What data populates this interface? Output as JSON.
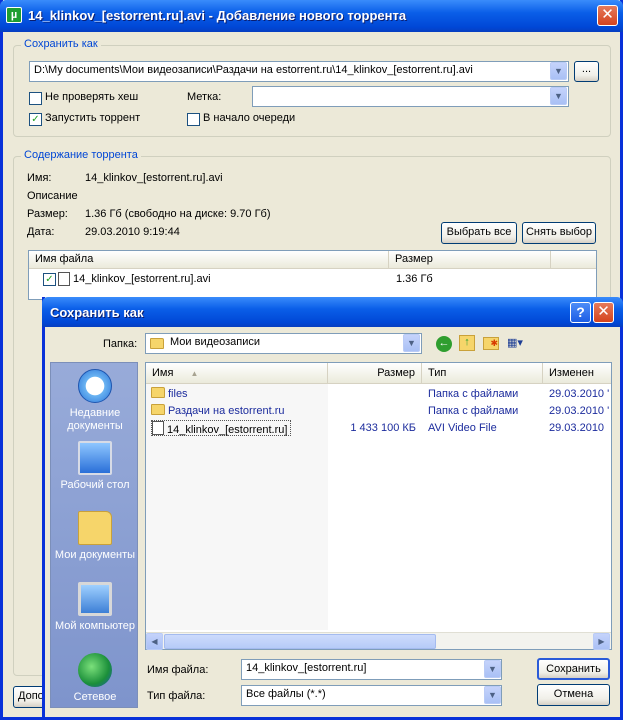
{
  "main": {
    "title": "14_klinkov_[estorrent.ru].avi - Добавление нового торрента",
    "save_as_group": "Сохранить как",
    "save_path": "D:\\My documents\\Мои видеозаписи\\Раздачи на estorrent.ru\\14_klinkov_[estorrent.ru].avi",
    "browse_label": "...",
    "skip_hash_label": "Не проверять хеш",
    "skip_hash_checked": false,
    "label_label": "Метка:",
    "label_value": "",
    "start_torrent_label": "Запустить торрент",
    "start_torrent_checked": true,
    "queue_top_label": "В начало очереди",
    "queue_top_checked": false,
    "content_group": "Содержание торрента",
    "name_key": "Имя:",
    "name_value": "14_klinkov_[estorrent.ru].avi",
    "description_key": "Описание",
    "size_key": "Размер:",
    "size_value": "1.36 Гб (свободно на диске: 9.70 Гб)",
    "date_key": "Дата:",
    "date_value": "29.03.2010 9:19:44",
    "select_all_label": "Выбрать все",
    "deselect_label": "Снять выбор",
    "file_table": {
      "columns": [
        "Имя файла",
        "Размер"
      ],
      "rows": [
        {
          "name": "14_klinkov_[estorrent.ru].avi",
          "size": "1.36 Гб",
          "checked": true
        }
      ]
    },
    "bottom_button_partial": "Допо"
  },
  "dialog": {
    "title": "Сохранить как",
    "help_label": "?",
    "folder_label": "Папка:",
    "folder_value": "Мои видеозаписи",
    "places": [
      {
        "label": "Недавние документы",
        "icon": "recent-documents-icon"
      },
      {
        "label": "Рабочий стол",
        "icon": "desktop-icon"
      },
      {
        "label": "Мои документы",
        "icon": "my-documents-icon"
      },
      {
        "label": "Мой компьютер",
        "icon": "my-computer-icon"
      },
      {
        "label": "Сетевое",
        "icon": "network-icon"
      }
    ],
    "columns": [
      "Имя",
      "Размер",
      "Тип",
      "Изменен"
    ],
    "files": [
      {
        "name": "files",
        "size": "",
        "type": "Папка с файлами",
        "modified": "29.03.2010 '",
        "kind": "folder"
      },
      {
        "name": "Раздачи на estorrent.ru",
        "size": "",
        "type": "Папка с файлами",
        "modified": "29.03.2010 '",
        "kind": "folder"
      },
      {
        "name": "14_klinkov_[estorrent.ru]",
        "size": "1 433 100 КБ",
        "type": "AVI Video File",
        "modified": "29.03.2010",
        "kind": "file"
      }
    ],
    "filename_label": "Имя файла:",
    "filename_value": "14_klinkov_[estorrent.ru]",
    "filetype_label": "Тип файла:",
    "filetype_value": "Все файлы (*.*)",
    "save_label": "Сохранить",
    "cancel_label": "Отмена"
  },
  "colors": {
    "title_bar": "#0a5ee8",
    "window_bg": "#ece9d8",
    "group_label": "#0046d5",
    "link_blue": "#1c2c9d"
  }
}
